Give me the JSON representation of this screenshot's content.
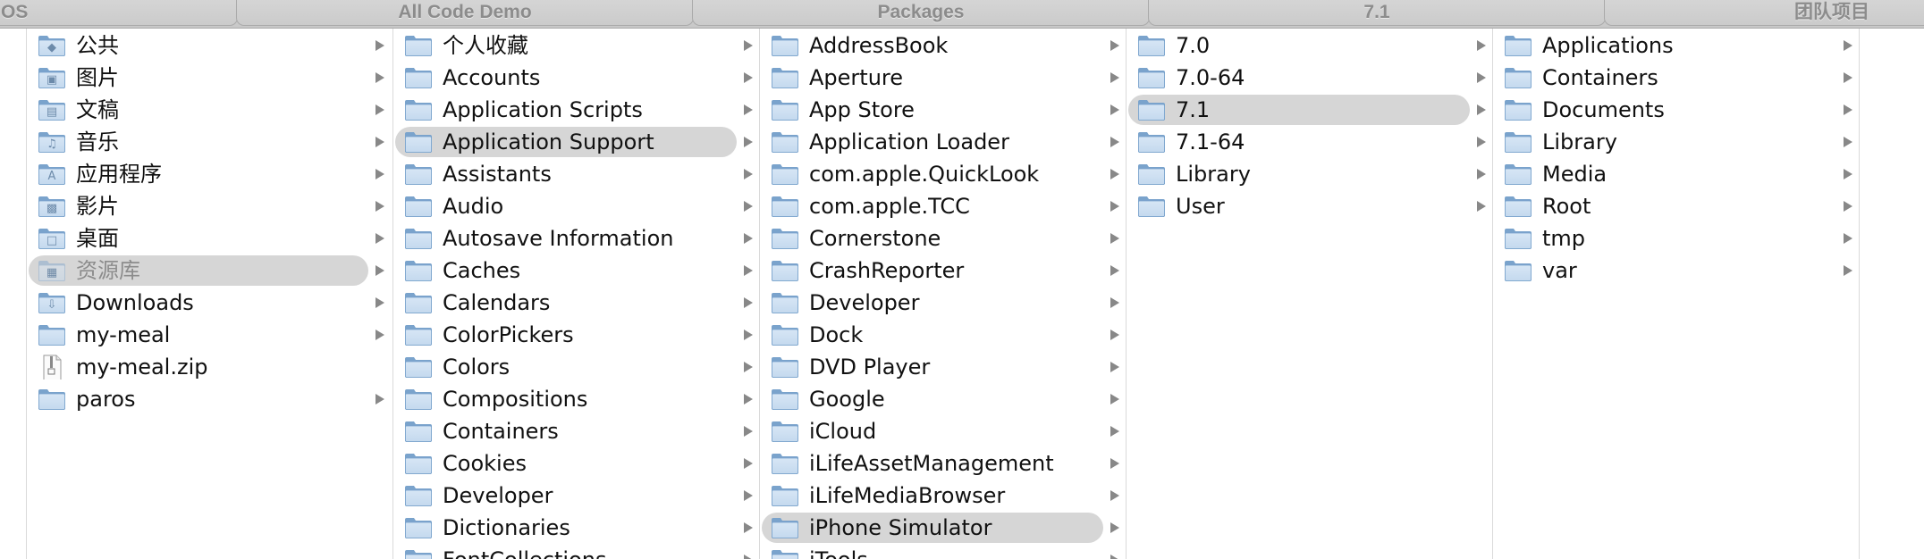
{
  "tabs": [
    {
      "label": "OS"
    },
    {
      "label": "All Code Demo"
    },
    {
      "label": "Packages"
    },
    {
      "label": "7.1"
    },
    {
      "label": "团队项目"
    }
  ],
  "colors": {
    "selection": "#d6d6d6",
    "folder_light": "#c4d9ee",
    "folder_dark": "#7aa3cc",
    "tab_text": "#8c8c8c"
  },
  "columns": [
    {
      "name": "sidebar",
      "items": [
        {
          "label": "公共",
          "icon": "public-folder-icon",
          "arrow": true
        },
        {
          "label": "图片",
          "icon": "pictures-folder-icon",
          "arrow": true
        },
        {
          "label": "文稿",
          "icon": "documents-folder-icon",
          "arrow": true
        },
        {
          "label": "音乐",
          "icon": "music-folder-icon",
          "arrow": true
        },
        {
          "label": "应用程序",
          "icon": "applications-folder-icon",
          "arrow": true
        },
        {
          "label": "影片",
          "icon": "movies-folder-icon",
          "arrow": true
        },
        {
          "label": "桌面",
          "icon": "desktop-folder-icon",
          "arrow": true
        },
        {
          "label": "资源库",
          "icon": "library-folder-icon",
          "arrow": true,
          "selected": true,
          "dim": true
        },
        {
          "label": "Downloads",
          "icon": "downloads-folder-icon",
          "arrow": true
        },
        {
          "label": "my-meal",
          "icon": "folder-icon",
          "arrow": true
        },
        {
          "label": "my-meal.zip",
          "icon": "zip-file-icon",
          "arrow": false
        },
        {
          "label": "paros",
          "icon": "folder-icon",
          "arrow": true
        }
      ]
    },
    {
      "name": "library",
      "items": [
        {
          "label": "个人收藏",
          "icon": "folder-icon",
          "arrow": true
        },
        {
          "label": "Accounts",
          "icon": "folder-icon",
          "arrow": true
        },
        {
          "label": "Application Scripts",
          "icon": "folder-icon",
          "arrow": true
        },
        {
          "label": "Application Support",
          "icon": "folder-icon",
          "arrow": true,
          "selected": true
        },
        {
          "label": "Assistants",
          "icon": "folder-icon",
          "arrow": true
        },
        {
          "label": "Audio",
          "icon": "folder-icon",
          "arrow": true
        },
        {
          "label": "Autosave Information",
          "icon": "folder-icon",
          "arrow": true
        },
        {
          "label": "Caches",
          "icon": "folder-icon",
          "arrow": true
        },
        {
          "label": "Calendars",
          "icon": "folder-icon",
          "arrow": true
        },
        {
          "label": "ColorPickers",
          "icon": "folder-icon",
          "arrow": true
        },
        {
          "label": "Colors",
          "icon": "folder-icon",
          "arrow": true
        },
        {
          "label": "Compositions",
          "icon": "folder-icon",
          "arrow": true
        },
        {
          "label": "Containers",
          "icon": "folder-icon",
          "arrow": true
        },
        {
          "label": "Cookies",
          "icon": "folder-icon",
          "arrow": true
        },
        {
          "label": "Developer",
          "icon": "folder-icon",
          "arrow": true
        },
        {
          "label": "Dictionaries",
          "icon": "folder-icon",
          "arrow": true
        },
        {
          "label": "FontCollections",
          "icon": "folder-icon",
          "arrow": true
        }
      ]
    },
    {
      "name": "application-support",
      "items": [
        {
          "label": "AddressBook",
          "icon": "folder-icon",
          "arrow": true
        },
        {
          "label": "Aperture",
          "icon": "folder-icon",
          "arrow": true
        },
        {
          "label": "App Store",
          "icon": "folder-icon",
          "arrow": true
        },
        {
          "label": "Application Loader",
          "icon": "folder-icon",
          "arrow": true
        },
        {
          "label": "com.apple.QuickLook",
          "icon": "folder-icon",
          "arrow": true
        },
        {
          "label": "com.apple.TCC",
          "icon": "folder-icon",
          "arrow": true
        },
        {
          "label": "Cornerstone",
          "icon": "folder-icon",
          "arrow": true
        },
        {
          "label": "CrashReporter",
          "icon": "folder-icon",
          "arrow": true
        },
        {
          "label": "Developer",
          "icon": "folder-icon",
          "arrow": true
        },
        {
          "label": "Dock",
          "icon": "folder-icon",
          "arrow": true
        },
        {
          "label": "DVD Player",
          "icon": "folder-icon",
          "arrow": true
        },
        {
          "label": "Google",
          "icon": "folder-icon",
          "arrow": true
        },
        {
          "label": "iCloud",
          "icon": "folder-icon",
          "arrow": true
        },
        {
          "label": "iLifeAssetManagement",
          "icon": "folder-icon",
          "arrow": true
        },
        {
          "label": "iLifeMediaBrowser",
          "icon": "folder-icon",
          "arrow": true
        },
        {
          "label": "iPhone Simulator",
          "icon": "folder-icon",
          "arrow": true,
          "selected": true
        },
        {
          "label": "iTools",
          "icon": "folder-icon",
          "arrow": true
        }
      ]
    },
    {
      "name": "iphone-simulator",
      "items": [
        {
          "label": "7.0",
          "icon": "folder-icon",
          "arrow": true
        },
        {
          "label": "7.0-64",
          "icon": "folder-icon",
          "arrow": true
        },
        {
          "label": "7.1",
          "icon": "folder-icon",
          "arrow": true,
          "selected": true
        },
        {
          "label": "7.1-64",
          "icon": "folder-icon",
          "arrow": true
        },
        {
          "label": "Library",
          "icon": "folder-icon",
          "arrow": true
        },
        {
          "label": "User",
          "icon": "folder-icon",
          "arrow": true
        }
      ]
    },
    {
      "name": "version-7-1",
      "items": [
        {
          "label": "Applications",
          "icon": "folder-icon",
          "arrow": true
        },
        {
          "label": "Containers",
          "icon": "folder-icon",
          "arrow": true
        },
        {
          "label": "Documents",
          "icon": "folder-icon",
          "arrow": true
        },
        {
          "label": "Library",
          "icon": "folder-icon",
          "arrow": true
        },
        {
          "label": "Media",
          "icon": "folder-icon",
          "arrow": true
        },
        {
          "label": "Root",
          "icon": "folder-icon",
          "arrow": true
        },
        {
          "label": "tmp",
          "icon": "folder-icon",
          "arrow": true
        },
        {
          "label": "var",
          "icon": "folder-icon",
          "arrow": true
        }
      ]
    }
  ]
}
